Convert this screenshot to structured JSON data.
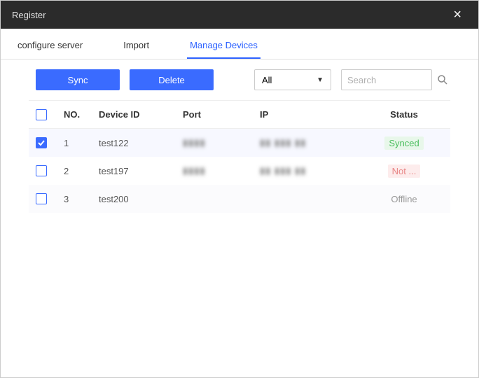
{
  "titlebar": {
    "title": "Register"
  },
  "tabs": [
    {
      "label": "configure server",
      "active": false
    },
    {
      "label": "Import",
      "active": false
    },
    {
      "label": "Manage Devices",
      "active": true
    }
  ],
  "toolbar": {
    "sync_label": "Sync",
    "delete_label": "Delete",
    "filter_selected": "All",
    "search_placeholder": "Search"
  },
  "table": {
    "headers": {
      "no": "NO.",
      "device_id": "Device ID",
      "port": "Port",
      "ip": "IP",
      "status": "Status"
    },
    "rows": [
      {
        "checked": true,
        "no": "1",
        "device_id": "test122",
        "port": "▮▮▮▮",
        "ip": "▮▮ ▮▮▮ ▮▮",
        "status_label": "Synced",
        "status_class": "s-synced"
      },
      {
        "checked": false,
        "no": "2",
        "device_id": "test197",
        "port": "▮▮▮▮",
        "ip": "▮▮ ▮▮▮ ▮▮",
        "status_label": "Not ...",
        "status_class": "s-not"
      },
      {
        "checked": false,
        "no": "3",
        "device_id": "test200",
        "port": "",
        "ip": "",
        "status_label": "Offline",
        "status_class": "s-offline"
      }
    ]
  }
}
